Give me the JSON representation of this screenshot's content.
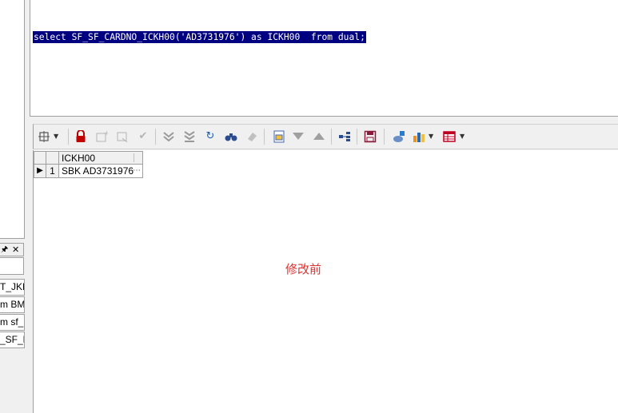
{
  "left_panel": {
    "pin_icon": "pin-icon",
    "close_icon": "close-icon",
    "items": [
      "T_JKR",
      "m BM",
      "m sf_k",
      "_SF_D"
    ]
  },
  "editor": {
    "sql": "select SF_SF_CARDNO_ICKH00('AD3731976') as ICKH00  from dual;",
    "selection_color": "#000080"
  },
  "toolbar": {
    "icons": [
      "grid-options-icon",
      "lock-icon",
      "insert-record-icon",
      "delete-record-icon",
      "post-changes-icon",
      "fetch-next-icon",
      "fetch-last-icon",
      "refresh-icon",
      "find-icon",
      "clear-icon",
      "query-by-example-icon",
      "filter-icon",
      "sort-icon",
      "record-tree-icon",
      "save-icon",
      "export-icon",
      "chart-icon",
      "table-view-icon"
    ]
  },
  "results": {
    "columns": [
      "ICKH00"
    ],
    "rows": [
      {
        "num": "1",
        "ICKH00": "SBK AD3731976"
      }
    ]
  },
  "annotation": {
    "text": "修改前",
    "color": "#e03030"
  }
}
